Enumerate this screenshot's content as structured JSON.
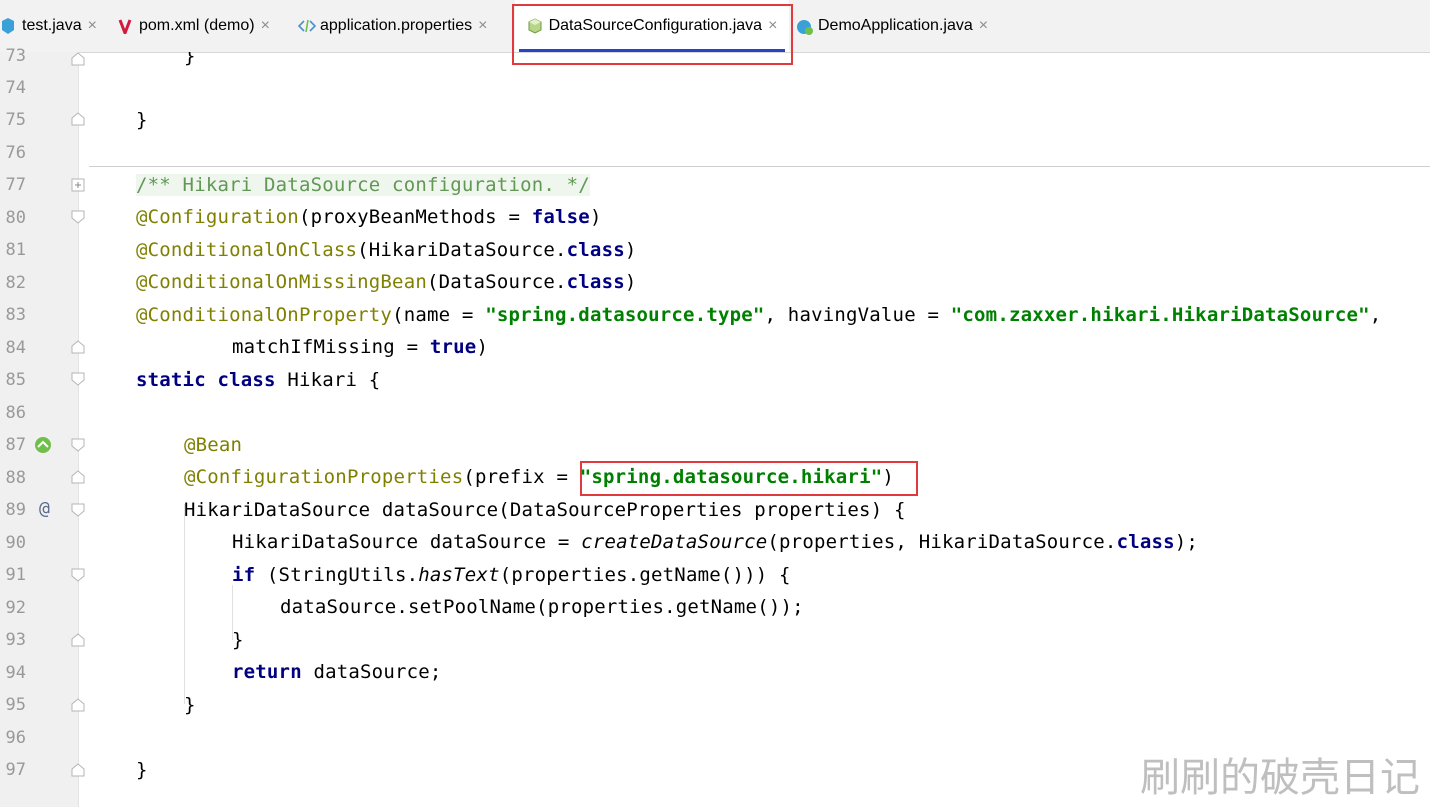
{
  "tabs": [
    {
      "label": "test.java",
      "icon": "java-class-icon"
    },
    {
      "label": "pom.xml (demo)",
      "icon": "maven-icon"
    },
    {
      "label": "application.properties",
      "icon": "properties-file-icon"
    },
    {
      "label": "DataSourceConfiguration.java",
      "icon": "java-config-class-icon",
      "active": true
    },
    {
      "label": "DemoApplication.java",
      "icon": "spring-boot-class-icon"
    }
  ],
  "close_glyph": "×",
  "line_numbers": [
    "73",
    "74",
    "75",
    "76",
    "77",
    "80",
    "81",
    "82",
    "83",
    "84",
    "85",
    "86",
    "87",
    "88",
    "89",
    "90",
    "91",
    "92",
    "93",
    "94",
    "95",
    "96",
    "97"
  ],
  "code": {
    "l73": "}",
    "l75": "}",
    "l77": "/** Hikari DataSource configuration. */",
    "l80": {
      "a": "@Configuration",
      "b": "(proxyBeanMethods = ",
      "c": "false",
      "d": ")"
    },
    "l81": {
      "a": "@ConditionalOnClass",
      "b": "(HikariDataSource.",
      "c": "class",
      "d": ")"
    },
    "l82": {
      "a": "@ConditionalOnMissingBean",
      "b": "(DataSource.",
      "c": "class",
      "d": ")"
    },
    "l83": {
      "a": "@ConditionalOnProperty",
      "b": "(name = ",
      "c": "\"spring.datasource.type\"",
      "d": ", havingValue = ",
      "e": "\"com.zaxxer.hikari.HikariDataSource\"",
      "f": ","
    },
    "l84": {
      "a": "matchIfMissing = ",
      "b": "true",
      "c": ")"
    },
    "l85": {
      "a": "static",
      "b": "class",
      "c": " Hikari {"
    },
    "l87": "@Bean",
    "l88": {
      "a": "@ConfigurationProperties",
      "b": "(prefix = ",
      "c": "\"spring.datasource.hikari\"",
      "d": ")"
    },
    "l89": "HikariDataSource dataSource(DataSourceProperties properties) {",
    "l90": {
      "a": "HikariDataSource dataSource = ",
      "b": "createDataSource",
      "c": "(properties, HikariDataSource.",
      "d": "class",
      "e": ");"
    },
    "l91": {
      "a": "if",
      "b": " (StringUtils.",
      "c": "hasText",
      "d": "(properties.getName())) {"
    },
    "l92": "dataSource.setPoolName(properties.getName());",
    "l93": "}",
    "l94": {
      "a": "return",
      "b": " dataSource;"
    },
    "l95": "}",
    "l97": "}"
  },
  "gutter_marks": {
    "l87": "spring-bean-icon",
    "l89": "@"
  },
  "colors": {
    "keyword": "#000080",
    "annotation": "#808000",
    "string": "#008000",
    "highlight": "#e0393e",
    "tab_underline": "#2744c9"
  },
  "watermark": "刷刷的破壳日记"
}
